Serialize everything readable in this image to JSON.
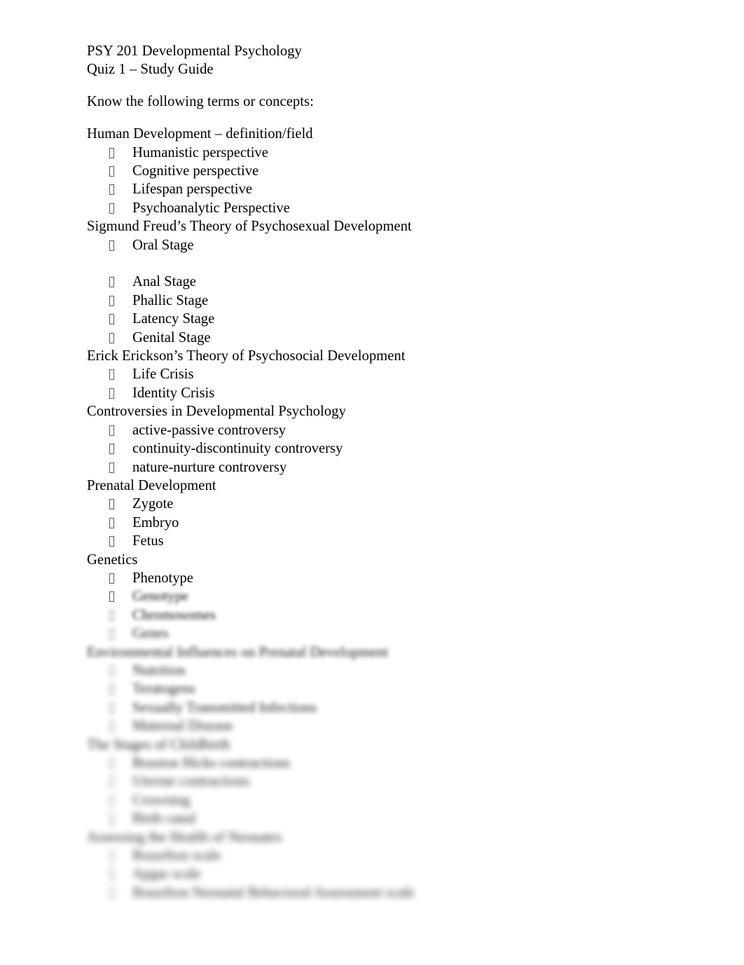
{
  "document": {
    "background_color": "#ffffff",
    "text_color": "#000000",
    "header": {
      "course_line": "PSY 201 Developmental Psychology",
      "quiz_line": "Quiz 1 – Study Guide"
    },
    "instruction": {
      "text": "Know the following terms or concepts:",
      "highlight_color": "#f3f3f3"
    },
    "bullet_glyph_name": "missing-glyph-box",
    "sections": [
      {
        "heading": "Human Development – definition/field",
        "blurred": false,
        "items": [
          {
            "label": "Humanistic perspective",
            "blurred": false
          },
          {
            "label": "Cognitive perspective",
            "blurred": false
          },
          {
            "label": "Lifespan perspective",
            "blurred": false
          },
          {
            "label": "Psychoanalytic Perspective",
            "blurred": false
          }
        ]
      },
      {
        "heading": "Sigmund Freud’s Theory of Psychosexual Development",
        "blurred": false,
        "items": [
          {
            "label": "Oral Stage",
            "blurred": false,
            "blank_after": true
          },
          {
            "label": "Anal Stage",
            "blurred": false
          },
          {
            "label": "Phallic Stage",
            "blurred": false
          },
          {
            "label": "Latency Stage",
            "blurred": false
          },
          {
            "label": "Genital Stage",
            "blurred": false
          }
        ]
      },
      {
        "heading": "Erick Erickson’s Theory of Psychosocial Development",
        "blurred": false,
        "items": [
          {
            "label": "Life Crisis",
            "blurred": false
          },
          {
            "label": "Identity Crisis",
            "blurred": false
          }
        ]
      },
      {
        "heading": "Controversies in Developmental Psychology",
        "blurred": false,
        "items": [
          {
            "label": "active-passive controversy",
            "blurred": false
          },
          {
            "label": "continuity-discontinuity controversy",
            "blurred": false
          },
          {
            "label": "nature-nurture controversy",
            "blurred": false
          }
        ]
      },
      {
        "heading": "Prenatal Development",
        "blurred": false,
        "items": [
          {
            "label": "Zygote",
            "blurred": false
          },
          {
            "label": "Embryo",
            "blurred": false
          },
          {
            "label": "Fetus",
            "blurred": false
          }
        ]
      },
      {
        "heading": "Genetics",
        "blurred": false,
        "items": [
          {
            "label": "Phenotype",
            "blurred": false
          },
          {
            "label": "Genotype",
            "blurred": true,
            "blur_level": 1
          },
          {
            "label": "Chromosomes",
            "blurred": true,
            "blur_level": 1
          },
          {
            "label": "Genes",
            "blurred": true,
            "blur_level": 2
          }
        ]
      },
      {
        "heading": "Environmental Influences on Prenatal Development",
        "blurred": true,
        "blur_level": 2,
        "items": [
          {
            "label": "Nutrition",
            "blurred": true,
            "blur_level": 3
          },
          {
            "label": "Teratogens",
            "blurred": true,
            "blur_level": 3
          },
          {
            "label": "Sexually Transmitted Infections",
            "blurred": true,
            "blur_level": 3
          },
          {
            "label": "Maternal Disease",
            "blurred": true,
            "blur_level": 4
          }
        ]
      },
      {
        "heading": "The Stages of Childbirth",
        "blurred": true,
        "blur_level": 4,
        "items": [
          {
            "label": "Braxton Hicks contractions",
            "blurred": true,
            "blur_level": 4
          },
          {
            "label": "Uterine contractions",
            "blurred": true,
            "blur_level": 5
          },
          {
            "label": "Crowning",
            "blurred": true,
            "blur_level": 5
          },
          {
            "label": "Birth canal",
            "blurred": true,
            "blur_level": 5
          }
        ]
      },
      {
        "heading": "Assessing the Health of Neonates",
        "blurred": true,
        "blur_level": 5,
        "items": [
          {
            "label": "Brazelton scale",
            "blurred": true,
            "blur_level": 6
          },
          {
            "label": "Apgar scale",
            "blurred": true,
            "blur_level": 6
          },
          {
            "label": "Brazelton Neonatal Behavioral Assessment scale",
            "blurred": true,
            "blur_level": 6
          }
        ]
      }
    ]
  }
}
